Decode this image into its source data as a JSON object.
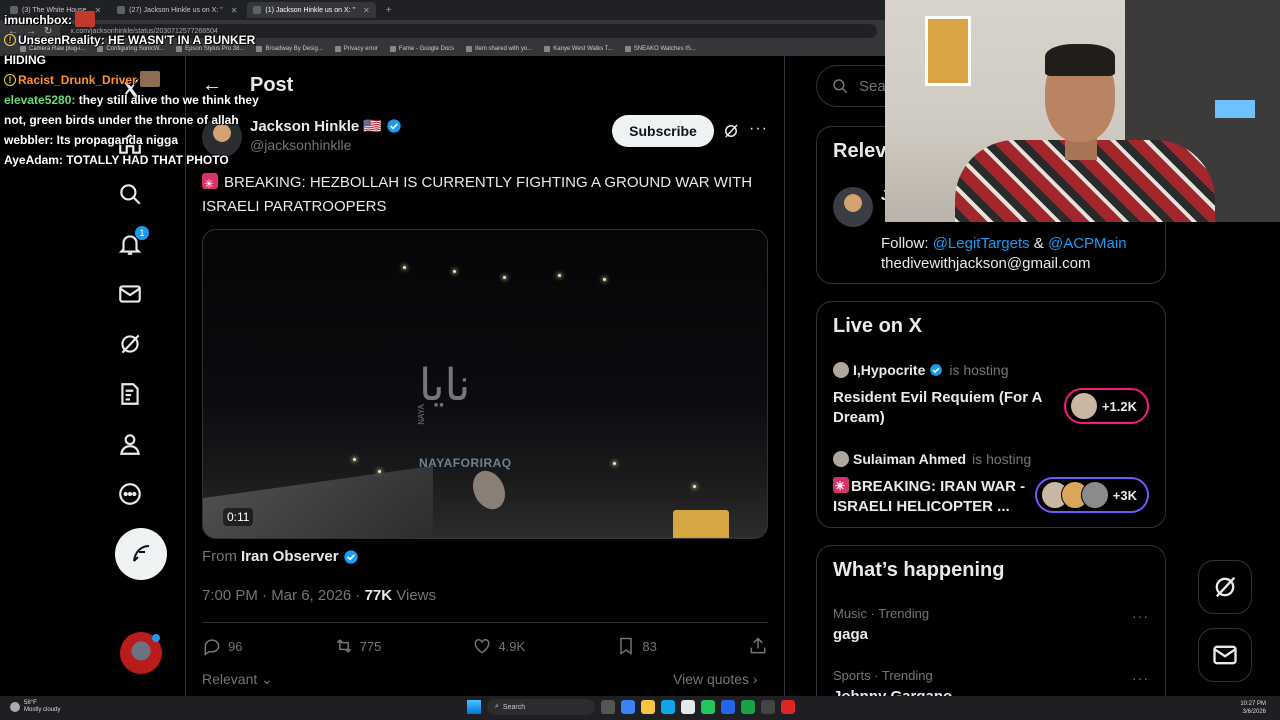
{
  "browser": {
    "tabs": [
      {
        "label": "(3) The White House",
        "active": false
      },
      {
        "label": "(27) Jackson Hinkle us on X: \"",
        "active": false
      },
      {
        "label": "(1) Jackson Hinkle us on X: \"",
        "active": true
      }
    ],
    "new_tab_glyph": "+",
    "url": "x.com/jacksonhinkle/status/2030712577268504",
    "bookmarks": [
      "Camera Raw plug-i...",
      "Configuring SonicW...",
      "Epson Stylus Pro 38...",
      "Broadway By Desig...",
      "Privacy error",
      "Fame - Google Docs",
      "Item shared with yo...",
      "Kanye West Walks T...",
      "SNEAKO Watches IS..."
    ]
  },
  "chat": [
    {
      "user": "imunchbox:",
      "text": "",
      "color": "#ffffff",
      "badge": false
    },
    {
      "user": "UnseenReality:",
      "text": " HE WASN'T IN A BUNKER HIDING",
      "color": "#ffffff",
      "badge": true
    },
    {
      "user": "Racist_Drunk_Driver",
      "text": "",
      "color": "#ff922b",
      "badge": true
    },
    {
      "user": "elevate5280:",
      "text": " they still alive tho we think they not, green birds under the throne of allah",
      "color": "#69db7c",
      "badge": false
    },
    {
      "user": "webbler:",
      "text": " Its propaganda nigga",
      "color": "#ffffff",
      "badge": false
    },
    {
      "user": "AyeAdam:",
      "text": " TOTALLY HAD THAT PHOTO",
      "color": "#ffffff",
      "badge": false
    }
  ],
  "nav": {
    "notifications_badge": "1"
  },
  "post": {
    "header_title": "Post",
    "back_glyph": "←",
    "author_name": "Jackson Hinkle 🇺🇸",
    "author_handle": "@jacksonhinklle",
    "subscribe_label": "Subscribe",
    "more_glyph": "···",
    "text": "BREAKING: HEZBOLLAH IS CURRENTLY FIGHTING A GROUND WAR WITH ISRAELI PARATROOPERS",
    "video": {
      "watermark": "نايا",
      "watermark_sub": "NAYAFORIRAQ",
      "naya_vertical": "NAYA",
      "duration": "0:11"
    },
    "from_prefix": "From",
    "from_source": "Iran Observer",
    "time": "7:00 PM · Mar 6, 2026 · ",
    "views_count": "77K",
    "views_label": " Views",
    "actions": {
      "replies": "96",
      "reposts": "775",
      "likes": "4.9K",
      "bookmarks": "83"
    },
    "relevant_label": "Relevant",
    "view_quotes_label": "View quotes"
  },
  "sidebar": {
    "search_placeholder": "Search",
    "relevant_title": "Relevant people",
    "relevant_person_initial": "J",
    "bio_follow": "Follow: ",
    "bio_link1": "@LegitTargets",
    "bio_amp": " & ",
    "bio_link2": "@ACPMain",
    "bio_email": "thedivewithjackson@gmail.com",
    "live_title": "Live on X",
    "spaces": [
      {
        "host": "I,Hypocrite",
        "tag": "is hosting",
        "title": "Resident Evil Requiem (For A Dream)",
        "listeners": "+1.2K",
        "pill_color": "#f91880"
      },
      {
        "host": "Sulaiman Ahmed",
        "tag": "is hosting",
        "title": "BREAKING: IRAN WAR - ISRAELI HELICOPTER ...",
        "listeners": "+3K",
        "pill_color": "#7856ff"
      }
    ],
    "happening_title": "What’s happening",
    "trends": [
      {
        "category": "Music · Trending",
        "name": "gaga"
      },
      {
        "category": "Sports · Trending",
        "name": "Johnny Gargano"
      }
    ]
  },
  "taskbar": {
    "weather_temp": "58°F",
    "weather_desc": "Mostly cloudy",
    "search_label": "Search",
    "time": "10:27 PM",
    "date": "3/6/2026"
  },
  "colors": {
    "accent": "#1d9bf0",
    "background": "#000000",
    "text_primary": "#e7e9ea",
    "text_secondary": "#71767b",
    "border": "#2f3336"
  }
}
